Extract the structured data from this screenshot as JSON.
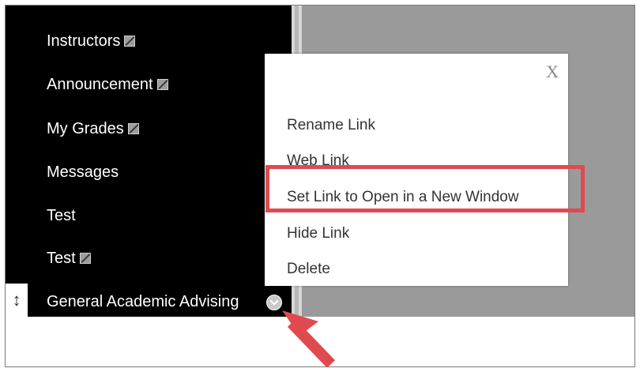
{
  "sidebar": {
    "items": [
      {
        "label": "Instructors",
        "hidden": true
      },
      {
        "label": "Announcement",
        "hidden": true
      },
      {
        "label": "My Grades",
        "hidden": true
      },
      {
        "label": "Messages",
        "hidden": false
      },
      {
        "label": "Test",
        "hidden": false
      },
      {
        "label": "Test",
        "hidden": true
      },
      {
        "label": "General Academic Advising",
        "hidden": false
      }
    ],
    "drag_handle": "↕"
  },
  "dropdown": {
    "close_label": "X",
    "items": [
      {
        "label": "Rename Link"
      },
      {
        "label": "Web Link"
      },
      {
        "label": "Set Link to Open in a New Window",
        "highlighted": true
      },
      {
        "label": "Hide Link"
      },
      {
        "label": "Delete"
      }
    ]
  },
  "colors": {
    "sidebar_bg": "#000000",
    "content_bg": "#9a9a9a",
    "highlight": "#e04a4f"
  },
  "icons": {
    "hidden_marker": "eye-slash-icon",
    "menu_toggle": "chevron-down-icon",
    "annotation": "red-arrow-icon"
  }
}
